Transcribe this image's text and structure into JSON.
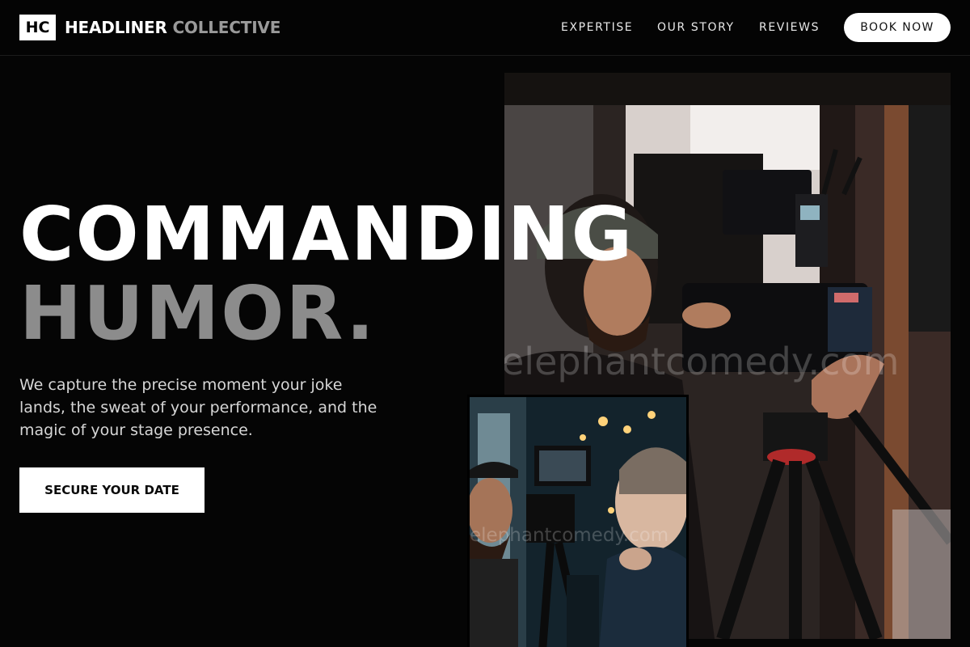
{
  "header": {
    "logo_mark": "HC",
    "brand_primary": "HEADLINER",
    "brand_secondary": "COLLECTIVE",
    "nav": [
      "EXPERTISE",
      "OUR STORY",
      "REVIEWS"
    ],
    "cta_label": "BOOK NOW"
  },
  "hero": {
    "headline_line1": "COMMANDING",
    "headline_line2": "HUMOR.",
    "description": "We capture the precise moment your joke lands, the sweat of your performance, and the magic of your stage presence.",
    "cta_label": "SECURE YOUR DATE"
  },
  "images": {
    "main_watermark": "elephantcomedy.com",
    "small_watermark": "elephantcomedy.com",
    "main_subject": "camera operator with cinema camera on tripod",
    "small_subject": "two men looking at camera monitor"
  },
  "colors": {
    "background": "#050505",
    "accent_text": "#ffffff",
    "muted_text": "#8c8c8c",
    "button_bg": "#ffffff"
  }
}
